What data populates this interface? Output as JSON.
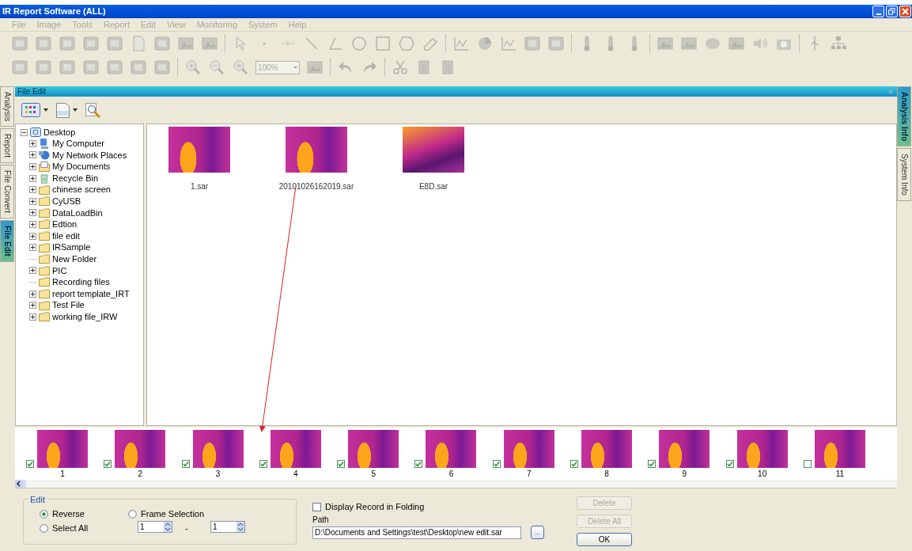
{
  "window": {
    "title": "IR Report Software (ALL)"
  },
  "menu": [
    {
      "label": "File"
    },
    {
      "label": "Image"
    },
    {
      "label": "Tools"
    },
    {
      "label": "Report"
    },
    {
      "label": "Edit"
    },
    {
      "label": "View"
    },
    {
      "label": "Monitoring"
    },
    {
      "label": "System"
    },
    {
      "label": "Help"
    }
  ],
  "zoom_box": {
    "value": "100%"
  },
  "left_tabs": [
    {
      "label": "Analysis",
      "selected": false
    },
    {
      "label": "Report",
      "selected": false
    },
    {
      "label": "File Convert",
      "selected": false
    },
    {
      "label": "File Edit",
      "selected": true
    }
  ],
  "right_tabs": [
    {
      "label": "Analysis Info",
      "selected": true
    },
    {
      "label": "System Info",
      "selected": false
    }
  ],
  "panel": {
    "title": "File Edit"
  },
  "tree": {
    "label": "Desktop",
    "expanded": true,
    "children": [
      {
        "label": "My Computer",
        "kind": "computer",
        "expandable": true
      },
      {
        "label": "My Network Places",
        "kind": "network",
        "expandable": true
      },
      {
        "label": "My Documents",
        "kind": "documents",
        "expandable": true
      },
      {
        "label": "Recycle Bin",
        "kind": "recycle",
        "expandable": true
      },
      {
        "label": "chinese screen",
        "kind": "folder",
        "expandable": true
      },
      {
        "label": "CyUSB",
        "kind": "folder",
        "expandable": true
      },
      {
        "label": "DataLoadBin",
        "kind": "folder",
        "expandable": true
      },
      {
        "label": "Edtion",
        "kind": "folder",
        "expandable": true
      },
      {
        "label": "file edit",
        "kind": "folder",
        "expandable": true
      },
      {
        "label": "IRSample",
        "kind": "folder",
        "expandable": true
      },
      {
        "label": "New Folder",
        "kind": "folder",
        "expandable": false
      },
      {
        "label": "PIC",
        "kind": "folder",
        "expandable": true
      },
      {
        "label": "Recording files",
        "kind": "folder",
        "expandable": false
      },
      {
        "label": "report template_IRT",
        "kind": "folder",
        "expandable": true
      },
      {
        "label": "Test File",
        "kind": "folder",
        "expandable": true
      },
      {
        "label": "working file_IRW",
        "kind": "folder",
        "expandable": true
      }
    ]
  },
  "files": [
    {
      "name": "1.sar"
    },
    {
      "name": "20101026162019.sar"
    },
    {
      "name": "E8D.sar"
    }
  ],
  "frames": [
    {
      "label": "1",
      "checked": true
    },
    {
      "label": "2",
      "checked": true
    },
    {
      "label": "3",
      "checked": true
    },
    {
      "label": "4",
      "checked": true
    },
    {
      "label": "5",
      "checked": true
    },
    {
      "label": "6",
      "checked": true
    },
    {
      "label": "7",
      "checked": true
    },
    {
      "label": "8",
      "checked": true
    },
    {
      "label": "9",
      "checked": true
    },
    {
      "label": "10",
      "checked": true
    },
    {
      "label": "11",
      "checked": false
    }
  ],
  "edit": {
    "title": "Edit",
    "options": [
      {
        "label": "Reverse",
        "selected": true
      },
      {
        "label": "Select All",
        "selected": false
      },
      {
        "label": "Frame Selection",
        "selected": false
      }
    ],
    "from": "1",
    "separator": "-",
    "to": "1"
  },
  "folding": {
    "label": "Display Record in Folding",
    "checked": false
  },
  "path": {
    "label": "Path",
    "value": "D:\\Documents and Settings\\test\\Desktop\\new edit.sar",
    "browse": "..."
  },
  "buttons": [
    {
      "label": "Delete",
      "disabled": true
    },
    {
      "label": "Delete All",
      "disabled": true
    },
    {
      "label": "OK",
      "disabled": false
    }
  ]
}
